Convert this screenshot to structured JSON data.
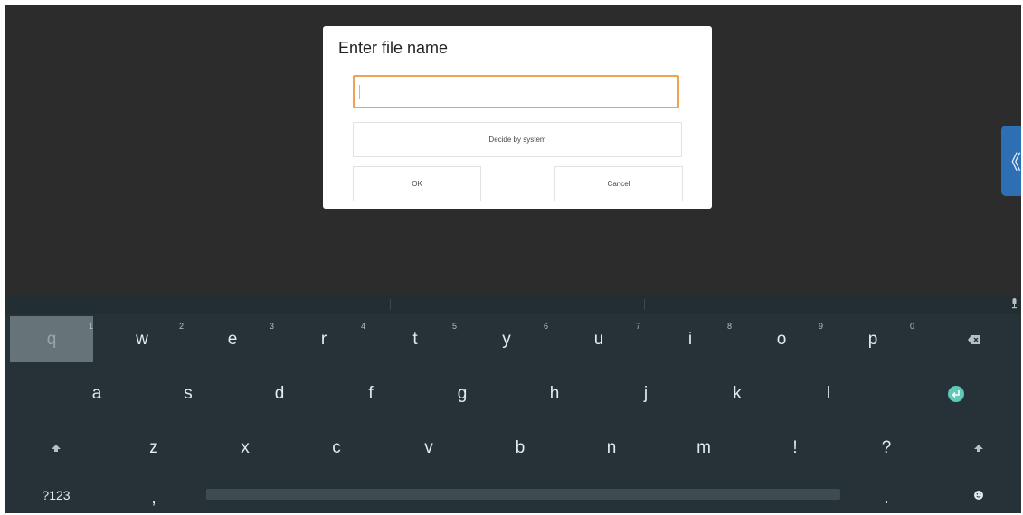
{
  "dialog": {
    "title": "Enter file name",
    "input_value": "",
    "decide_label": "Decide by system",
    "ok_label": "OK",
    "cancel_label": "Cancel"
  },
  "side_handle": {
    "icon": "double-chevron-left-icon",
    "glyph": "《"
  },
  "colors": {
    "background": "#2c2c2c",
    "dialog": "#ffffff",
    "input_focus_border": "#f0a24e",
    "keyboard": "#263238",
    "enter_key": "#5fc9b8",
    "handle": "#2e6fb4"
  },
  "keyboard": {
    "row1": [
      {
        "label": "q",
        "hint": "1"
      },
      {
        "label": "w",
        "hint": "2"
      },
      {
        "label": "e",
        "hint": "3"
      },
      {
        "label": "r",
        "hint": "4"
      },
      {
        "label": "t",
        "hint": "5"
      },
      {
        "label": "y",
        "hint": "6"
      },
      {
        "label": "u",
        "hint": "7"
      },
      {
        "label": "i",
        "hint": "8"
      },
      {
        "label": "o",
        "hint": "9"
      },
      {
        "label": "p",
        "hint": "0"
      }
    ],
    "row2": [
      "a",
      "s",
      "d",
      "f",
      "g",
      "h",
      "j",
      "k",
      "l"
    ],
    "row3": [
      "z",
      "x",
      "c",
      "v",
      "b",
      "n",
      "m",
      "!",
      "?"
    ],
    "symbols_label": "?123",
    "comma_label": ",",
    "period_label": ".",
    "pressed_key": "q"
  }
}
